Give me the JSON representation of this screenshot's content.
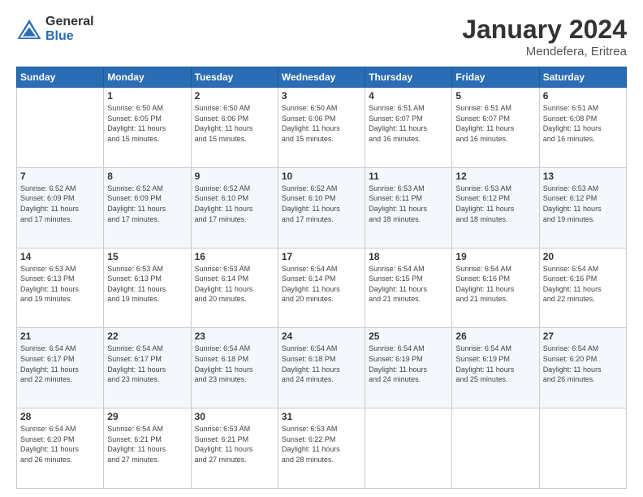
{
  "logo": {
    "general": "General",
    "blue": "Blue"
  },
  "title": "January 2024",
  "subtitle": "Mendefera, Eritrea",
  "days": [
    "Sunday",
    "Monday",
    "Tuesday",
    "Wednesday",
    "Thursday",
    "Friday",
    "Saturday"
  ],
  "weeks": [
    [
      {
        "day": "",
        "info": ""
      },
      {
        "day": "1",
        "info": "Sunrise: 6:50 AM\nSunset: 6:05 PM\nDaylight: 11 hours\nand 15 minutes."
      },
      {
        "day": "2",
        "info": "Sunrise: 6:50 AM\nSunset: 6:06 PM\nDaylight: 11 hours\nand 15 minutes."
      },
      {
        "day": "3",
        "info": "Sunrise: 6:50 AM\nSunset: 6:06 PM\nDaylight: 11 hours\nand 15 minutes."
      },
      {
        "day": "4",
        "info": "Sunrise: 6:51 AM\nSunset: 6:07 PM\nDaylight: 11 hours\nand 16 minutes."
      },
      {
        "day": "5",
        "info": "Sunrise: 6:51 AM\nSunset: 6:07 PM\nDaylight: 11 hours\nand 16 minutes."
      },
      {
        "day": "6",
        "info": "Sunrise: 6:51 AM\nSunset: 6:08 PM\nDaylight: 11 hours\nand 16 minutes."
      }
    ],
    [
      {
        "day": "7",
        "info": "Sunrise: 6:52 AM\nSunset: 6:09 PM\nDaylight: 11 hours\nand 17 minutes."
      },
      {
        "day": "8",
        "info": "Sunrise: 6:52 AM\nSunset: 6:09 PM\nDaylight: 11 hours\nand 17 minutes."
      },
      {
        "day": "9",
        "info": "Sunrise: 6:52 AM\nSunset: 6:10 PM\nDaylight: 11 hours\nand 17 minutes."
      },
      {
        "day": "10",
        "info": "Sunrise: 6:52 AM\nSunset: 6:10 PM\nDaylight: 11 hours\nand 17 minutes."
      },
      {
        "day": "11",
        "info": "Sunrise: 6:53 AM\nSunset: 6:11 PM\nDaylight: 11 hours\nand 18 minutes."
      },
      {
        "day": "12",
        "info": "Sunrise: 6:53 AM\nSunset: 6:12 PM\nDaylight: 11 hours\nand 18 minutes."
      },
      {
        "day": "13",
        "info": "Sunrise: 6:53 AM\nSunset: 6:12 PM\nDaylight: 11 hours\nand 19 minutes."
      }
    ],
    [
      {
        "day": "14",
        "info": "Sunrise: 6:53 AM\nSunset: 6:13 PM\nDaylight: 11 hours\nand 19 minutes."
      },
      {
        "day": "15",
        "info": "Sunrise: 6:53 AM\nSunset: 6:13 PM\nDaylight: 11 hours\nand 19 minutes."
      },
      {
        "day": "16",
        "info": "Sunrise: 6:53 AM\nSunset: 6:14 PM\nDaylight: 11 hours\nand 20 minutes."
      },
      {
        "day": "17",
        "info": "Sunrise: 6:54 AM\nSunset: 6:14 PM\nDaylight: 11 hours\nand 20 minutes."
      },
      {
        "day": "18",
        "info": "Sunrise: 6:54 AM\nSunset: 6:15 PM\nDaylight: 11 hours\nand 21 minutes."
      },
      {
        "day": "19",
        "info": "Sunrise: 6:54 AM\nSunset: 6:16 PM\nDaylight: 11 hours\nand 21 minutes."
      },
      {
        "day": "20",
        "info": "Sunrise: 6:54 AM\nSunset: 6:16 PM\nDaylight: 11 hours\nand 22 minutes."
      }
    ],
    [
      {
        "day": "21",
        "info": "Sunrise: 6:54 AM\nSunset: 6:17 PM\nDaylight: 11 hours\nand 22 minutes."
      },
      {
        "day": "22",
        "info": "Sunrise: 6:54 AM\nSunset: 6:17 PM\nDaylight: 11 hours\nand 23 minutes."
      },
      {
        "day": "23",
        "info": "Sunrise: 6:54 AM\nSunset: 6:18 PM\nDaylight: 11 hours\nand 23 minutes."
      },
      {
        "day": "24",
        "info": "Sunrise: 6:54 AM\nSunset: 6:18 PM\nDaylight: 11 hours\nand 24 minutes."
      },
      {
        "day": "25",
        "info": "Sunrise: 6:54 AM\nSunset: 6:19 PM\nDaylight: 11 hours\nand 24 minutes."
      },
      {
        "day": "26",
        "info": "Sunrise: 6:54 AM\nSunset: 6:19 PM\nDaylight: 11 hours\nand 25 minutes."
      },
      {
        "day": "27",
        "info": "Sunrise: 6:54 AM\nSunset: 6:20 PM\nDaylight: 11 hours\nand 26 minutes."
      }
    ],
    [
      {
        "day": "28",
        "info": "Sunrise: 6:54 AM\nSunset: 6:20 PM\nDaylight: 11 hours\nand 26 minutes."
      },
      {
        "day": "29",
        "info": "Sunrise: 6:54 AM\nSunset: 6:21 PM\nDaylight: 11 hours\nand 27 minutes."
      },
      {
        "day": "30",
        "info": "Sunrise: 6:53 AM\nSunset: 6:21 PM\nDaylight: 11 hours\nand 27 minutes."
      },
      {
        "day": "31",
        "info": "Sunrise: 6:53 AM\nSunset: 6:22 PM\nDaylight: 11 hours\nand 28 minutes."
      },
      {
        "day": "",
        "info": ""
      },
      {
        "day": "",
        "info": ""
      },
      {
        "day": "",
        "info": ""
      }
    ]
  ]
}
